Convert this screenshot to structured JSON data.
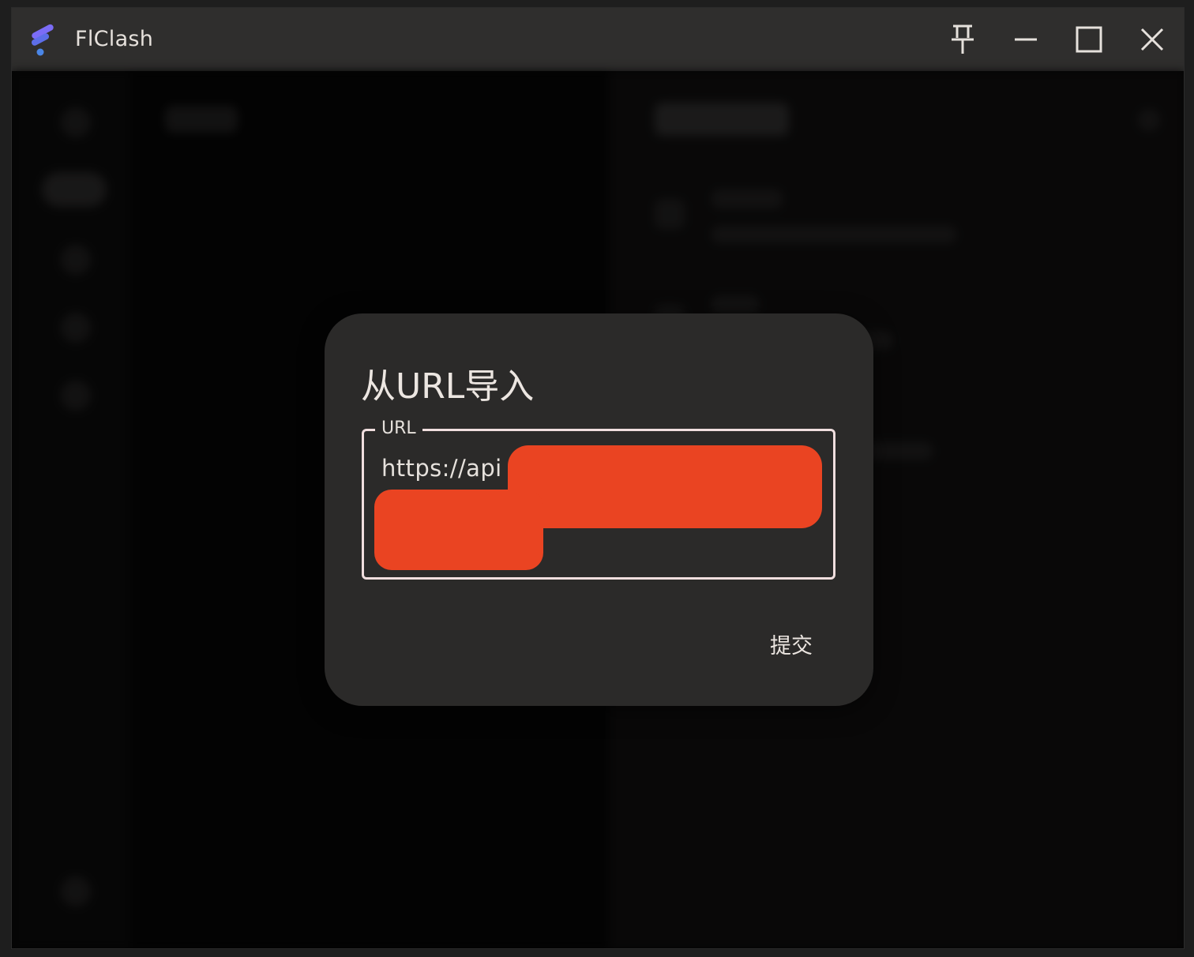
{
  "window": {
    "title": "FlClash",
    "controls": {
      "pin_icon": "pin-icon",
      "minimize_icon": "minimize-icon",
      "maximize_icon": "maximize-icon",
      "close_icon": "close-icon"
    }
  },
  "dialog": {
    "title": "从URL导入",
    "url_field": {
      "label": "URL",
      "value": "https://api"
    },
    "submit_label": "提交"
  },
  "colors": {
    "titlebar": "#2f2e2d",
    "dialog_bg": "#2b2a29",
    "field_border": "#f0dede",
    "redaction": "#ea4422",
    "logo_purple": "#6a6cf6",
    "logo_blue": "#4a7fe0"
  }
}
